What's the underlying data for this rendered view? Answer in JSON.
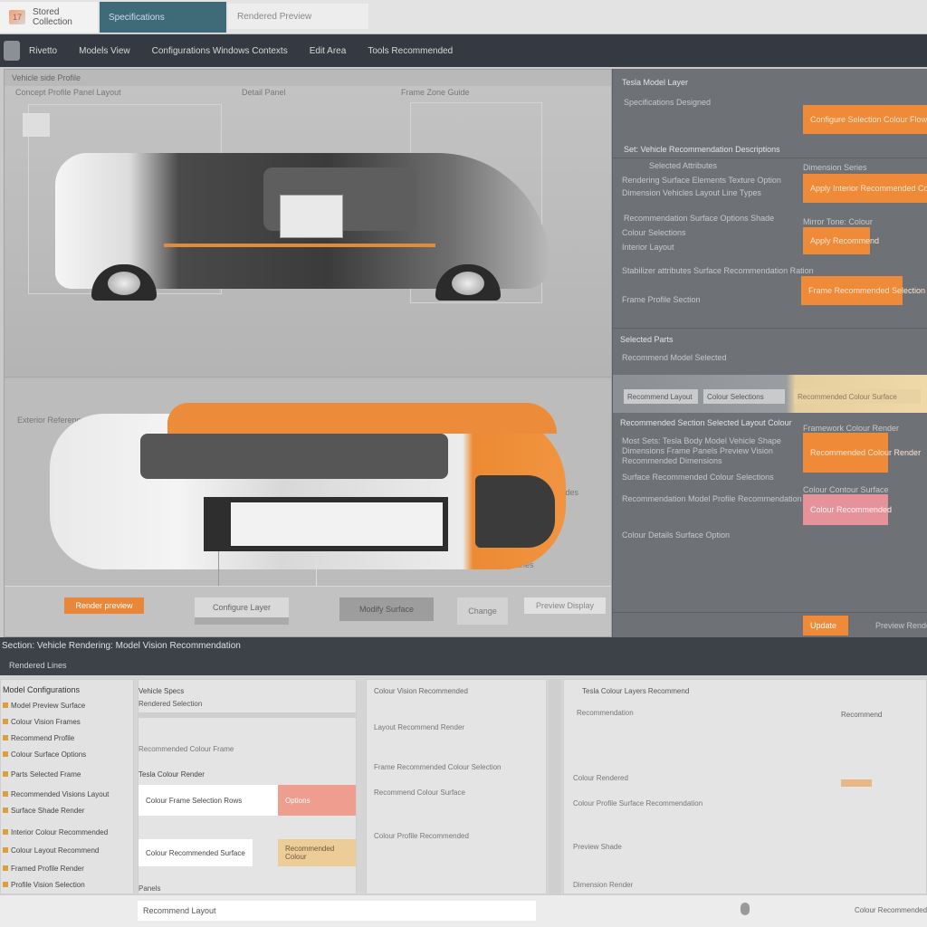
{
  "tabs": [
    "Stored Collection",
    "Specifications",
    "Rendered Preview"
  ],
  "menu": {
    "brand": "Rivetto",
    "items": [
      "Models View",
      "Configurations Windows Contexts",
      "Edit Area",
      "Tools Recommended"
    ]
  },
  "canvas": {
    "title": "Vehicle side Profile",
    "top_ruler": [
      "Concept Profile Panel Layout",
      "Detail Panel",
      "Frame Zone Guide"
    ],
    "side_labels": [
      "Exterior Reference",
      "Panel Guides",
      "Body Lines"
    ],
    "toolbar": [
      "Render preview",
      "Configure Layer",
      "Modify Surface",
      "Change",
      "Preview Display"
    ]
  },
  "props": {
    "title": "Tesla Model Layer",
    "header_line": "Specifications Designed",
    "top_button": "Configure Selection Colour Flow",
    "section1": "Set: Vehicle Recommendation Descriptions",
    "row1": "Selected Attributes",
    "label_apply": "Dimension Series",
    "btn_apply": "Apply Interior Recommended Contours",
    "row2": "Rendering Surface Elements Texture Option",
    "row3": "Dimension Vehicles Layout Line Types",
    "label_mini": "Mirror Tone: Colour",
    "btn_mini": "Apply Recommend",
    "row4": "Stabilizer attributes Surface Recommendation Ration",
    "btn_wide": "Frame Recommended Selection",
    "row5": "Recommendation Surface Options Shade",
    "row6": "Colour Selections",
    "row7": "Interior Layout",
    "row8": "Frame Profile Section",
    "strip": [
      "Recommend Layout",
      "Colour Selections",
      "Recommended Colour Surface"
    ],
    "row9": "Selected Parts",
    "para1": "Most Sets: Tesla Body Model Vehicle Shape Dimensions Frame Panels Preview Vision Recommended Dimensions",
    "row10": "Recommend Model Selected",
    "row11": "Recommended Section Selected Layout Colour",
    "label_orange2": "Framework Colour Render",
    "btn_orange2": "Recommended Colour Render",
    "label_pink": "Colour Contour Surface",
    "btn_pink": "Colour Recommended",
    "row12": "Surface Recommended Colour Selections",
    "row13": "Recommendation Model Profile Recommendation Section",
    "row14": "Colour Details Surface Option",
    "footer_btn": "Update",
    "footer_text": "Preview Rendered"
  },
  "status": {
    "line1": "Section: Vehicle Rendering: Model Vision Recommendation",
    "line2": "Rendered Lines"
  },
  "bottom": {
    "list_header": "Model Configurations",
    "list_items": [
      "Model Preview Surface",
      "Colour Vision Frames",
      "Recommend Profile",
      "Colour Surface Options",
      "Parts Selected Frame",
      "Recommended Visions Layout",
      "Surface Shade Render",
      "Interior Colour Recommended",
      "Colour Layout Recommend",
      "Framed Profile Render",
      "Profile Vision Selection"
    ],
    "form_header": "Vehicle Specs",
    "form_sub": "Rendered Selection",
    "form_row1": "Recommended Colour Frame",
    "form_label": "Tesla Colour Render",
    "field1": "Colour Frame Selection Rows",
    "field1_side": "Options",
    "field2": "Colour Recommended Surface",
    "field2_side": "Recommended Colour",
    "form_footer": "Panels",
    "log_header": "Colour Vision Recommended",
    "log_lines": [
      "Layout Recommend Render",
      "Frame Recommended Colour Selection",
      "Recommend Colour Surface",
      "Colour Profile Recommended"
    ],
    "detail_header": "Tesla Colour Layers Recommend",
    "detail_lines": [
      "Recommendation",
      "Colour Rendered",
      "Colour Profile Surface Recommendation",
      "Preview Shade",
      "Dimension Render"
    ],
    "detail_side": "Recommend",
    "bottom_input": "Recommend Layout",
    "bottom_right": "Colour Recommended"
  }
}
